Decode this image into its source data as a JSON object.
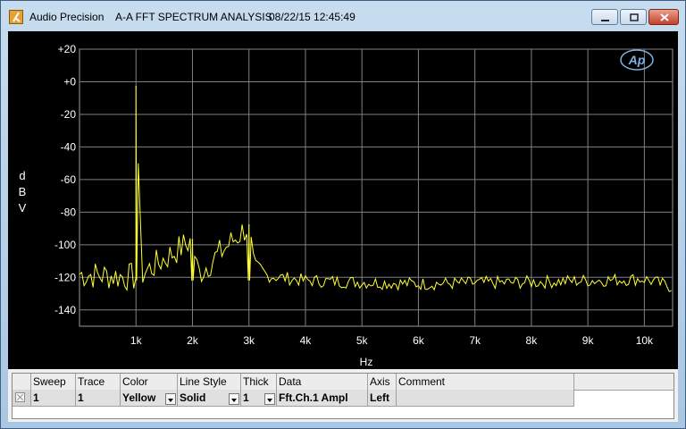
{
  "window": {
    "app_name": "Audio Precision",
    "graph_title": "A-A FFT SPECTRUM ANALYSIS",
    "timestamp": "08/22/15 12:45:49",
    "controls": [
      "minimize-icon",
      "restore-icon",
      "close-icon"
    ],
    "logo_text": "Ap"
  },
  "chart_data": {
    "type": "line",
    "x_axis_label": "Hz",
    "y_axis_label_letters": [
      "d",
      "B",
      "V"
    ],
    "xlim": [
      0,
      10500
    ],
    "ylim": [
      -150,
      20
    ],
    "x_ticks": [
      1000,
      2000,
      3000,
      4000,
      5000,
      6000,
      7000,
      8000,
      9000,
      10000
    ],
    "x_tick_labels": [
      "1k",
      "2k",
      "3k",
      "4k",
      "5k",
      "6k",
      "7k",
      "8k",
      "9k",
      "10k"
    ],
    "y_ticks": [
      20,
      0,
      -20,
      -40,
      -60,
      -80,
      -100,
      -120,
      -140
    ],
    "y_tick_labels": [
      "+20",
      "+0",
      "-20",
      "-40",
      "-60",
      "-80",
      "-100",
      "-120",
      "-140"
    ],
    "grid": true,
    "series": [
      {
        "color": "#ffff33",
        "x": [
          0,
          1000,
          1000,
          1100,
          2000,
          2100,
          3000,
          3100,
          4000,
          6000,
          8000,
          10000,
          10500
        ],
        "y": [
          -118,
          -120,
          -3,
          -118,
          -97,
          -118,
          -88,
          -118,
          -122,
          -124,
          -123,
          -121,
          -126
        ],
        "noise_floor_dBV": -122,
        "peaks": [
          {
            "x": 1000,
            "y": -3
          },
          {
            "x": 2000,
            "y": -97
          },
          {
            "x": 3000,
            "y": -88
          }
        ]
      }
    ]
  },
  "table": {
    "columns": [
      "",
      "Sweep",
      "Trace",
      "Color",
      "Line Style",
      "Thick",
      "Data",
      "Axis",
      "Comment"
    ],
    "rows": [
      {
        "sweep": "1",
        "trace": "1",
        "color": "Yellow",
        "line_style": "Solid",
        "thick": "1",
        "data": "Fft.Ch.1 Ampl",
        "axis": "Left",
        "comment": ""
      }
    ]
  }
}
